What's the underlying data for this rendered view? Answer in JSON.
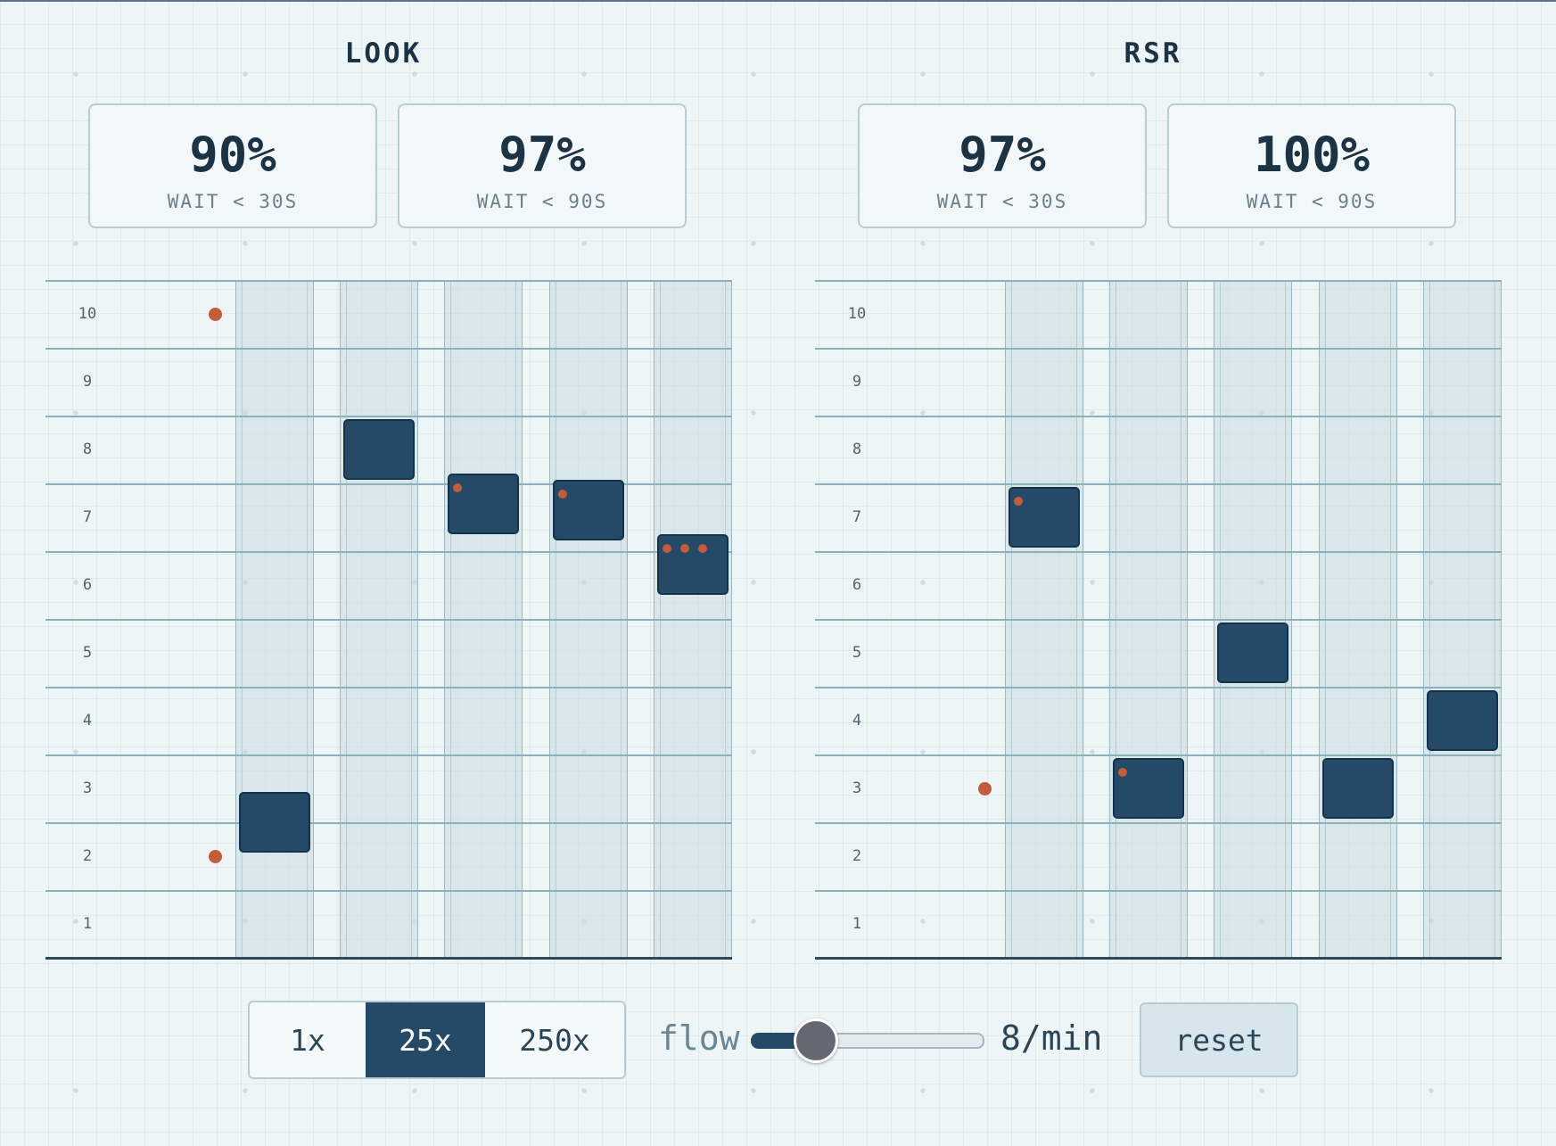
{
  "panels": [
    {
      "id": "look",
      "title": "LOOK",
      "stats": [
        {
          "value": "90%",
          "label": "WAIT < 30S"
        },
        {
          "value": "97%",
          "label": "WAIT < 90S"
        }
      ],
      "floors": [
        "10",
        "9",
        "8",
        "7",
        "6",
        "5",
        "4",
        "3",
        "2",
        "1"
      ],
      "cars": [
        {
          "floor": 2.5,
          "riders": 0
        },
        {
          "floor": 8.0,
          "riders": 0
        },
        {
          "floor": 7.2,
          "riders": 1
        },
        {
          "floor": 7.1,
          "riders": 1
        },
        {
          "floor": 6.3,
          "riders": 3
        }
      ],
      "waiting": [
        10,
        2
      ]
    },
    {
      "id": "rsr",
      "title": "RSR",
      "stats": [
        {
          "value": "97%",
          "label": "WAIT < 30S"
        },
        {
          "value": "100%",
          "label": "WAIT < 90S"
        }
      ],
      "floors": [
        "10",
        "9",
        "8",
        "7",
        "6",
        "5",
        "4",
        "3",
        "2",
        "1"
      ],
      "cars": [
        {
          "floor": 7.0,
          "riders": 1
        },
        {
          "floor": 3.0,
          "riders": 1
        },
        {
          "floor": 5.0,
          "riders": 0
        },
        {
          "floor": 3.0,
          "riders": 0
        },
        {
          "floor": 4.0,
          "riders": 0
        }
      ],
      "waiting": [
        3
      ]
    }
  ],
  "controls": {
    "speeds": [
      "1x",
      "25x",
      "250x"
    ],
    "active_speed": "25x",
    "flow_label": "flow",
    "flow_value": "8/min",
    "flow_level": 0.22,
    "reset_label": "reset"
  },
  "colors": {
    "car": "#244a68",
    "rider": "#c45b3c",
    "background": "#eef5f7"
  }
}
